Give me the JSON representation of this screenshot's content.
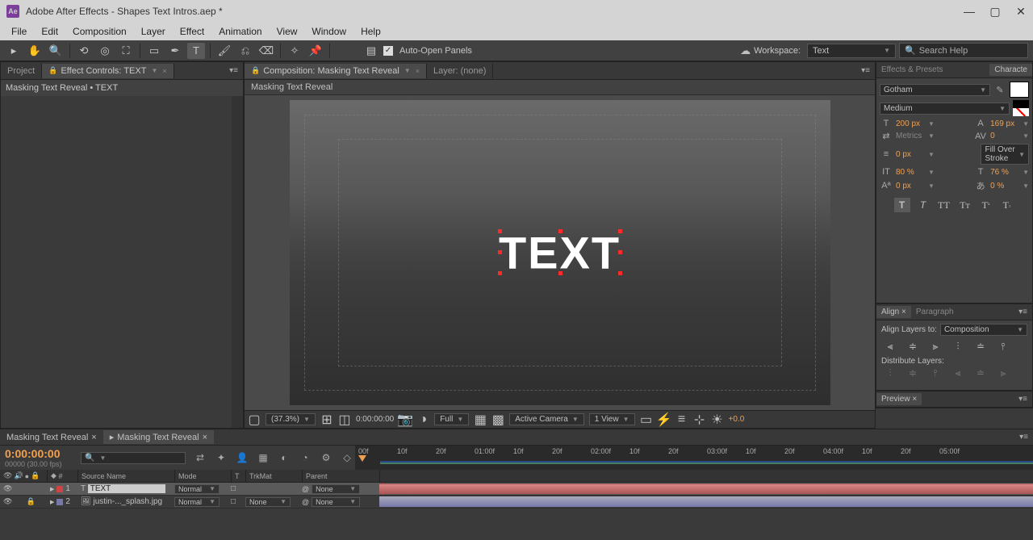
{
  "window": {
    "title": "Adobe After Effects - Shapes Text Intros.aep *"
  },
  "menu": {
    "items": [
      "File",
      "Edit",
      "Composition",
      "Layer",
      "Effect",
      "Animation",
      "View",
      "Window",
      "Help"
    ]
  },
  "toolbar": {
    "auto_open": "Auto-Open Panels",
    "workspace_label": "Workspace:",
    "workspace_value": "Text",
    "search_placeholder": "Search Help"
  },
  "project": {
    "tab_project": "Project",
    "tab_ec": "Effect Controls: TEXT",
    "subtitle": "Masking Text Reveal • TEXT"
  },
  "comp": {
    "tab_label": "Composition: Masking Text Reveal",
    "layer_tab": "Layer: (none)",
    "crumb": "Masking Text Reveal",
    "text": "TEXT",
    "zoom": "(37.3%)",
    "timecode": "0:00:00:00",
    "quality": "Full",
    "camera": "Active Camera",
    "views": "1 View",
    "exposure": "+0.0"
  },
  "char": {
    "panel_ep": "Effects & Presets",
    "panel_char": "Characte",
    "font": "Gotham",
    "style": "Medium",
    "size": "200 px",
    "leading": "169 px",
    "kerning": "Metrics",
    "tracking": "0",
    "stroke_w": "0 px",
    "stroke_mode": "Fill Over Stroke",
    "v_scale": "80 %",
    "h_scale": "76 %",
    "baseline": "0 px",
    "tsume": "0 %"
  },
  "align": {
    "tab_align": "Align",
    "tab_para": "Paragraph",
    "to_label": "Align Layers to:",
    "to_value": "Composition",
    "dist_label": "Distribute Layers:"
  },
  "preview": {
    "tab": "Preview"
  },
  "timeline": {
    "tab1": "Masking Text Reveal",
    "tab2": "Masking Text Reveal",
    "timecode": "0:00:00:00",
    "rate": "00000 (30.00 fps)",
    "cols": {
      "num": "#",
      "src": "Source Name",
      "mode": "Mode",
      "t": "T",
      "trk": "TrkMat",
      "parent": "Parent"
    },
    "ruler": [
      "00f",
      "10f",
      "20f",
      "01:00f",
      "10f",
      "20f",
      "02:00f",
      "10f",
      "20f",
      "03:00f",
      "10f",
      "20f",
      "04:00f",
      "10f",
      "20f",
      "05:00f"
    ],
    "layers": [
      {
        "num": "1",
        "name": "TEXT",
        "mode": "Normal",
        "trk": "",
        "parent": "None",
        "bar": "text"
      },
      {
        "num": "2",
        "name": "justin-..._splash.jpg",
        "mode": "Normal",
        "trk": "None",
        "parent": "None",
        "bar": "img"
      }
    ]
  }
}
